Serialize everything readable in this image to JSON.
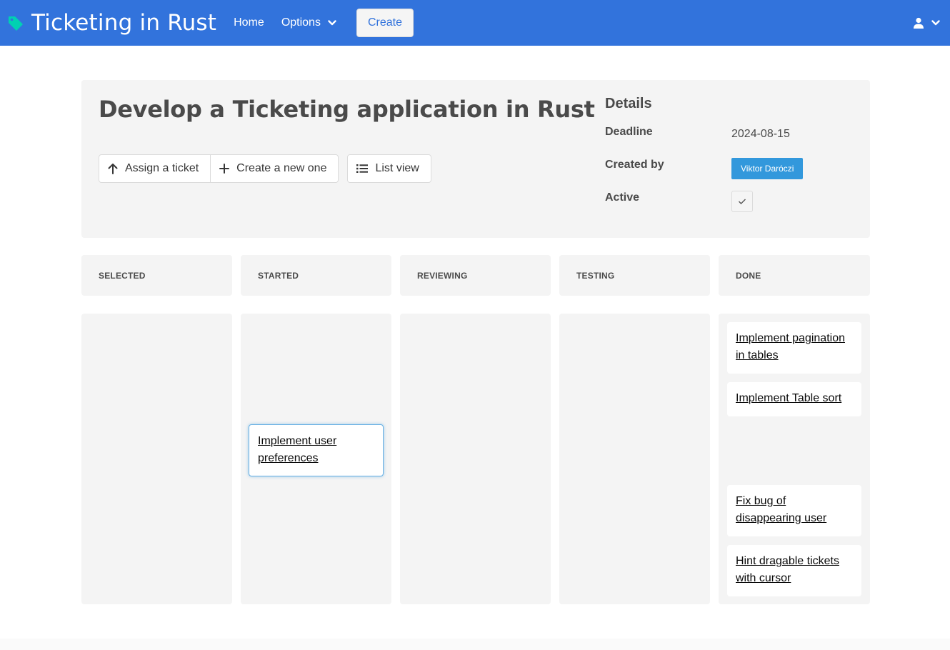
{
  "navbar": {
    "brand": "Ticketing in Rust",
    "home": "Home",
    "options": "Options",
    "create": "Create"
  },
  "project": {
    "title": "Develop a Ticketing application in Rust",
    "buttons": {
      "assign": "Assign a ticket",
      "create_new": "Create a new one",
      "list_view": "List view"
    },
    "details": {
      "title": "Details",
      "deadline_label": "Deadline",
      "deadline_value": "2024-08-15",
      "created_by_label": "Created by",
      "created_by_value": "Viktor Daróczi",
      "active_label": "Active",
      "active": true
    }
  },
  "columns": [
    {
      "name": "SELECTED",
      "tickets": []
    },
    {
      "name": "STARTED",
      "tickets": [
        "Implement user preferences"
      ]
    },
    {
      "name": "REVIEWING",
      "tickets": []
    },
    {
      "name": "TESTING",
      "tickets": []
    },
    {
      "name": "DONE",
      "tickets": [
        "Implement pagination in tables",
        "Implement Table sort",
        "Fix bug of disappearing user",
        "Hint dragable tickets with cursor"
      ]
    }
  ],
  "colors": {
    "primary": "#3273dc",
    "info": "#3298dc",
    "brand_icon": "#00d1b2"
  }
}
